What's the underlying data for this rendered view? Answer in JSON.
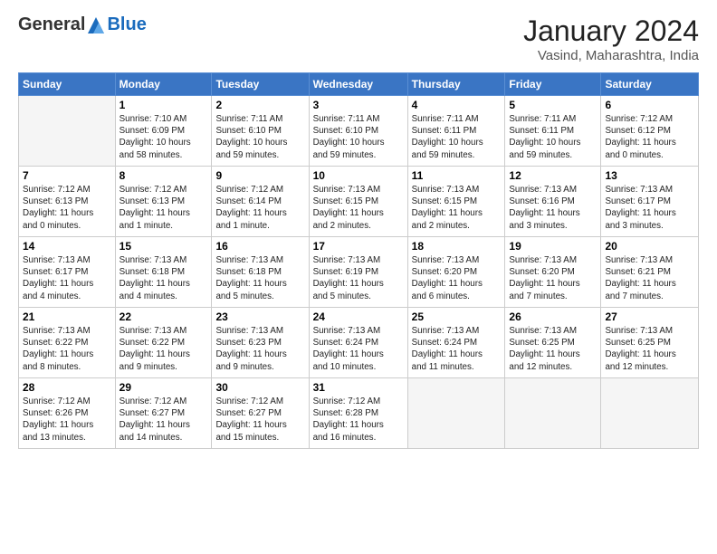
{
  "logo": {
    "general": "General",
    "blue": "Blue"
  },
  "title": "January 2024",
  "subtitle": "Vasind, Maharashtra, India",
  "days_header": [
    "Sunday",
    "Monday",
    "Tuesday",
    "Wednesday",
    "Thursday",
    "Friday",
    "Saturday"
  ],
  "weeks": [
    [
      {
        "num": "",
        "info": ""
      },
      {
        "num": "1",
        "info": "Sunrise: 7:10 AM\nSunset: 6:09 PM\nDaylight: 10 hours\nand 58 minutes."
      },
      {
        "num": "2",
        "info": "Sunrise: 7:11 AM\nSunset: 6:10 PM\nDaylight: 10 hours\nand 59 minutes."
      },
      {
        "num": "3",
        "info": "Sunrise: 7:11 AM\nSunset: 6:10 PM\nDaylight: 10 hours\nand 59 minutes."
      },
      {
        "num": "4",
        "info": "Sunrise: 7:11 AM\nSunset: 6:11 PM\nDaylight: 10 hours\nand 59 minutes."
      },
      {
        "num": "5",
        "info": "Sunrise: 7:11 AM\nSunset: 6:11 PM\nDaylight: 10 hours\nand 59 minutes."
      },
      {
        "num": "6",
        "info": "Sunrise: 7:12 AM\nSunset: 6:12 PM\nDaylight: 11 hours\nand 0 minutes."
      }
    ],
    [
      {
        "num": "7",
        "info": "Sunrise: 7:12 AM\nSunset: 6:13 PM\nDaylight: 11 hours\nand 0 minutes."
      },
      {
        "num": "8",
        "info": "Sunrise: 7:12 AM\nSunset: 6:13 PM\nDaylight: 11 hours\nand 1 minute."
      },
      {
        "num": "9",
        "info": "Sunrise: 7:12 AM\nSunset: 6:14 PM\nDaylight: 11 hours\nand 1 minute."
      },
      {
        "num": "10",
        "info": "Sunrise: 7:13 AM\nSunset: 6:15 PM\nDaylight: 11 hours\nand 2 minutes."
      },
      {
        "num": "11",
        "info": "Sunrise: 7:13 AM\nSunset: 6:15 PM\nDaylight: 11 hours\nand 2 minutes."
      },
      {
        "num": "12",
        "info": "Sunrise: 7:13 AM\nSunset: 6:16 PM\nDaylight: 11 hours\nand 3 minutes."
      },
      {
        "num": "13",
        "info": "Sunrise: 7:13 AM\nSunset: 6:17 PM\nDaylight: 11 hours\nand 3 minutes."
      }
    ],
    [
      {
        "num": "14",
        "info": "Sunrise: 7:13 AM\nSunset: 6:17 PM\nDaylight: 11 hours\nand 4 minutes."
      },
      {
        "num": "15",
        "info": "Sunrise: 7:13 AM\nSunset: 6:18 PM\nDaylight: 11 hours\nand 4 minutes."
      },
      {
        "num": "16",
        "info": "Sunrise: 7:13 AM\nSunset: 6:18 PM\nDaylight: 11 hours\nand 5 minutes."
      },
      {
        "num": "17",
        "info": "Sunrise: 7:13 AM\nSunset: 6:19 PM\nDaylight: 11 hours\nand 5 minutes."
      },
      {
        "num": "18",
        "info": "Sunrise: 7:13 AM\nSunset: 6:20 PM\nDaylight: 11 hours\nand 6 minutes."
      },
      {
        "num": "19",
        "info": "Sunrise: 7:13 AM\nSunset: 6:20 PM\nDaylight: 11 hours\nand 7 minutes."
      },
      {
        "num": "20",
        "info": "Sunrise: 7:13 AM\nSunset: 6:21 PM\nDaylight: 11 hours\nand 7 minutes."
      }
    ],
    [
      {
        "num": "21",
        "info": "Sunrise: 7:13 AM\nSunset: 6:22 PM\nDaylight: 11 hours\nand 8 minutes."
      },
      {
        "num": "22",
        "info": "Sunrise: 7:13 AM\nSunset: 6:22 PM\nDaylight: 11 hours\nand 9 minutes."
      },
      {
        "num": "23",
        "info": "Sunrise: 7:13 AM\nSunset: 6:23 PM\nDaylight: 11 hours\nand 9 minutes."
      },
      {
        "num": "24",
        "info": "Sunrise: 7:13 AM\nSunset: 6:24 PM\nDaylight: 11 hours\nand 10 minutes."
      },
      {
        "num": "25",
        "info": "Sunrise: 7:13 AM\nSunset: 6:24 PM\nDaylight: 11 hours\nand 11 minutes."
      },
      {
        "num": "26",
        "info": "Sunrise: 7:13 AM\nSunset: 6:25 PM\nDaylight: 11 hours\nand 12 minutes."
      },
      {
        "num": "27",
        "info": "Sunrise: 7:13 AM\nSunset: 6:25 PM\nDaylight: 11 hours\nand 12 minutes."
      }
    ],
    [
      {
        "num": "28",
        "info": "Sunrise: 7:12 AM\nSunset: 6:26 PM\nDaylight: 11 hours\nand 13 minutes."
      },
      {
        "num": "29",
        "info": "Sunrise: 7:12 AM\nSunset: 6:27 PM\nDaylight: 11 hours\nand 14 minutes."
      },
      {
        "num": "30",
        "info": "Sunrise: 7:12 AM\nSunset: 6:27 PM\nDaylight: 11 hours\nand 15 minutes."
      },
      {
        "num": "31",
        "info": "Sunrise: 7:12 AM\nSunset: 6:28 PM\nDaylight: 11 hours\nand 16 minutes."
      },
      {
        "num": "",
        "info": ""
      },
      {
        "num": "",
        "info": ""
      },
      {
        "num": "",
        "info": ""
      }
    ]
  ]
}
